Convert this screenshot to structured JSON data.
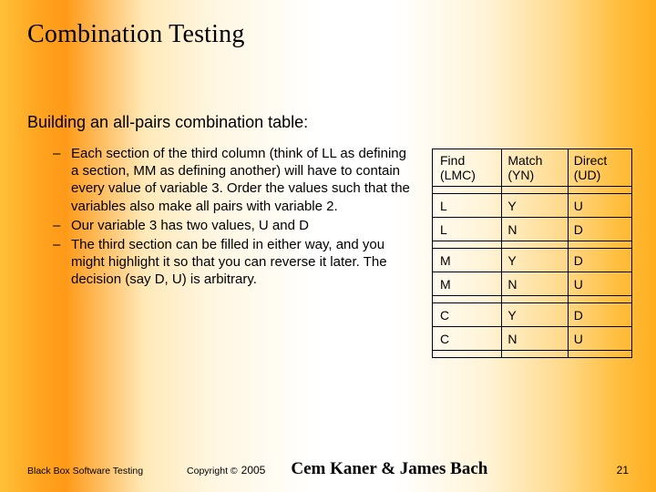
{
  "title": "Combination Testing",
  "subtitle": "Building an all-pairs combination table:",
  "bullets": [
    "Each section of the third column (think of LL as defining a section, MM as defining another) will have to contain every value of variable 3. Order the values such that the variables also make all pairs with variable 2.",
    "Our variable 3 has two values, U and D",
    "The third section can be filled in either way, and you might highlight it so that you can reverse it later. The decision (say D, U) is arbitrary."
  ],
  "table": {
    "headers": {
      "c0a": "Find",
      "c0b": "(LMC)",
      "c1a": "Match",
      "c1b": "(YN)",
      "c2a": "Direct",
      "c2b": "(UD)"
    },
    "rows": [
      {
        "c0": "L",
        "c1": "Y",
        "c2": "U"
      },
      {
        "c0": "L",
        "c1": "N",
        "c2": "D"
      },
      {
        "c0": "M",
        "c1": "Y",
        "c2": "D"
      },
      {
        "c0": "M",
        "c1": "N",
        "c2": "U"
      },
      {
        "c0": "C",
        "c1": "Y",
        "c2": "D"
      },
      {
        "c0": "C",
        "c1": "N",
        "c2": "U"
      }
    ]
  },
  "footer": {
    "left": "Black Box Software Testing",
    "copyright_label": "Copyright ©",
    "year": "2005",
    "authors": "Cem Kaner & James Bach",
    "page": "21"
  }
}
